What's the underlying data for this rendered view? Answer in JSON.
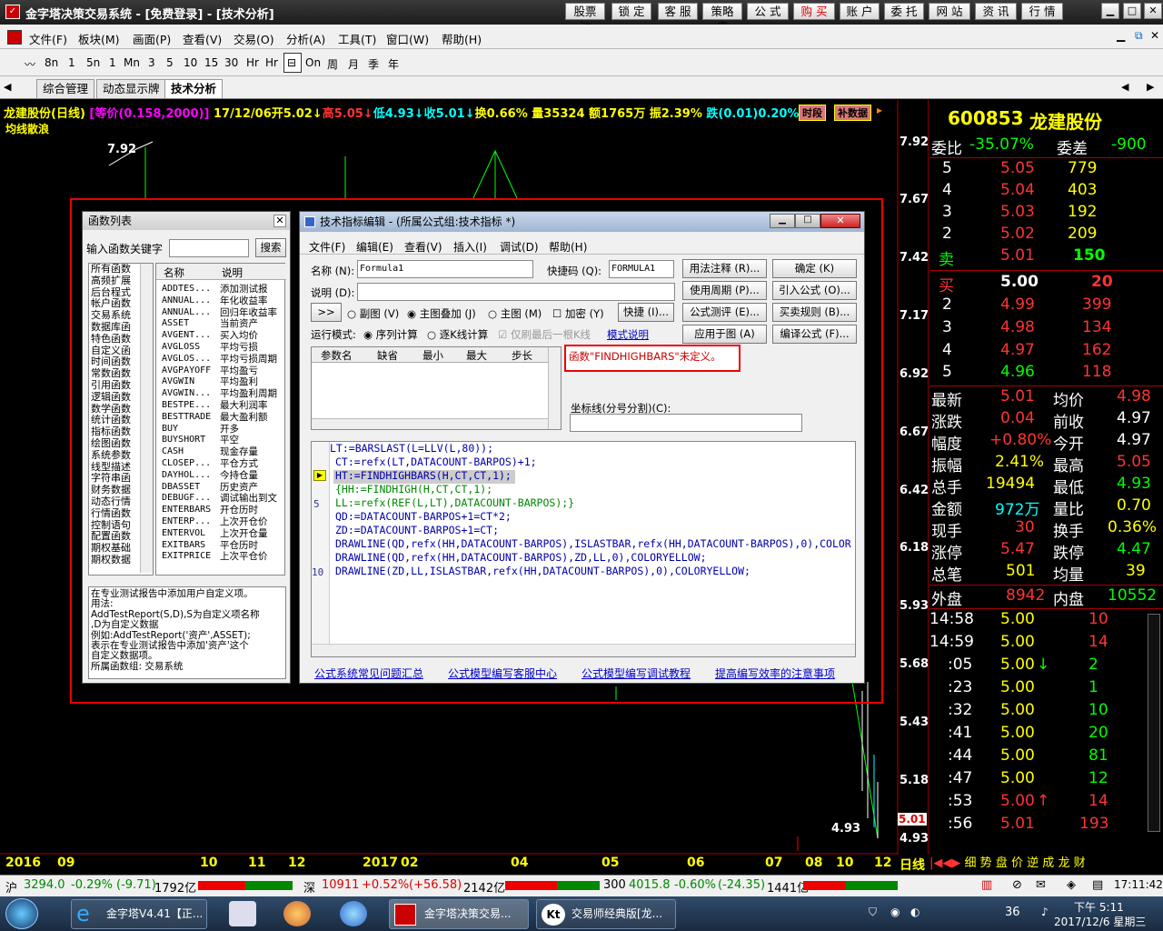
{
  "window": {
    "title": "金字塔决策交易系统 - [免费登录] - [技术分析]",
    "top_buttons": [
      "股票池",
      "锁 定",
      "客 服",
      "策略库",
      "公 式",
      "购 买",
      "账 户",
      "委 托",
      "网 站",
      "资 讯",
      "行 情"
    ]
  },
  "menu": [
    "文件(F)",
    "板块(M)",
    "画面(P)",
    "查看(V)",
    "交易(O)",
    "分析(A)",
    "工具(T)",
    "窗口(W)",
    "帮助(H)"
  ],
  "periods": [
    "5n",
    "1",
    "Mn",
    "3",
    "5",
    "10",
    "15",
    "30",
    "Hr",
    "On",
    "周",
    "月",
    "季",
    "年"
  ],
  "period_extra": "8n",
  "period_extra2": "1",
  "period_hr": "Hr",
  "tabs": [
    "综合管理",
    "动态显示牌",
    "技术分析"
  ],
  "chart": {
    "name": "龙建股份(日线)",
    "equal": "[等价(0.158,2000)]",
    "date": "17/12/06",
    "open": "开5.02↓",
    "high": "高5.05↓",
    "low": "低4.93↓",
    "close": "收5.01↓",
    "turnover": "换0.66%",
    "vol": "量35324",
    "amt": "额1765万",
    "amp": "振2.39%",
    "chg": "跌(0.01)0.20%",
    "btn_period": "时段",
    "btn_data": "补数据",
    "indicator": "均线散浪",
    "hi_label": "7.92",
    "lo_label": "4.93",
    "last_tag": "5.01",
    "price_levels": [
      "7.92",
      "7.67",
      "7.42",
      "7.17",
      "6.92",
      "6.67",
      "6.42",
      "6.18",
      "5.93",
      "5.68",
      "5.43",
      "5.18",
      "4.93"
    ],
    "time_ticks": [
      "2016",
      "09",
      "10",
      "11",
      "12",
      "2017",
      "02",
      "04",
      "05",
      "06",
      "07",
      "08",
      "10",
      "12"
    ],
    "axis_mode": "日线"
  },
  "quote": {
    "code": "600853",
    "name": "龙建股份",
    "ratio_label": "委比",
    "ratio": "-35.07%",
    "diff_label": "委差",
    "diff": "-900",
    "asks": [
      [
        "5",
        "5.05",
        "779"
      ],
      [
        "4",
        "5.04",
        "403"
      ],
      [
        "3",
        "5.03",
        "192"
      ],
      [
        "2",
        "5.02",
        "209"
      ],
      [
        "卖",
        "5.01",
        "150"
      ]
    ],
    "bids": [
      [
        "买",
        "5.00",
        "20"
      ],
      [
        "2",
        "4.99",
        "399"
      ],
      [
        "3",
        "4.98",
        "134"
      ],
      [
        "4",
        "4.97",
        "162"
      ],
      [
        "5",
        "4.96",
        "118"
      ]
    ],
    "stats": [
      [
        "最新",
        "5.01",
        "均价",
        "4.98"
      ],
      [
        "涨跌",
        "0.04",
        "前收",
        "4.97"
      ],
      [
        "幅度",
        "+0.80%",
        "今开",
        "4.97"
      ],
      [
        "振幅",
        "2.41%",
        "最高",
        "5.05"
      ],
      [
        "总手",
        "19494",
        "最低",
        "4.93"
      ],
      [
        "金额",
        "972万",
        "量比",
        "0.70"
      ],
      [
        "现手",
        "30",
        "换手",
        "0.36%"
      ],
      [
        "涨停",
        "5.47",
        "跌停",
        "4.47"
      ],
      [
        "总笔",
        "501",
        "均量",
        "39"
      ]
    ],
    "outer_label": "外盘",
    "outer": "8942",
    "inner_label": "内盘",
    "inner": "10552",
    "ticks": [
      [
        "14:58",
        "5.00",
        "",
        "10"
      ],
      [
        "14:59",
        "5.00",
        "",
        "14"
      ],
      [
        ":05",
        "5.00",
        "↓",
        "2"
      ],
      [
        ":23",
        "5.00",
        "",
        "1"
      ],
      [
        ":32",
        "5.00",
        "",
        "10"
      ],
      [
        ":41",
        "5.00",
        "",
        "20"
      ],
      [
        ":44",
        "5.00",
        "",
        "81"
      ],
      [
        ":47",
        "5.00",
        "",
        "12"
      ],
      [
        ":53",
        "5.00",
        "↑",
        "14"
      ],
      [
        ":56",
        "5.01",
        "",
        "193"
      ]
    ],
    "bottom_tabs": [
      "细",
      "势",
      "盘",
      "价",
      "逆",
      "成",
      "龙",
      "财"
    ]
  },
  "status": {
    "sh": "沪",
    "sh_val": "3294.0",
    "sh_pct": "-0.29%",
    "sh_chg": "(-9.71)",
    "sh_amt": "1792亿",
    "sz": "深",
    "sz_val": "10911",
    "sz_pct": "+0.52%",
    "sz_chg": "(+56.58)",
    "sz_amt": "2142亿",
    "cy": "300",
    "cy_val": "4015.8",
    "cy_pct": "-0.60%",
    "cy_chg": "(-24.35)",
    "cy_amt": "1441亿",
    "time": "17:11:42"
  },
  "taskbar": {
    "tasks": [
      "金字塔V4.41【正...",
      "金字塔决策交易...",
      "交易师经典版[龙..."
    ],
    "clock_time": "下午 5:11",
    "clock_date": "2017/12/6 星期三",
    "tray_num": "36"
  },
  "func_list": {
    "title": "函数列表",
    "search_label": "输入函数关键字",
    "search_btn": "搜索",
    "categories": [
      "所有函数",
      "高频扩展",
      "后台程式",
      "帐户函数",
      "交易系统",
      "数据库函",
      "特色函数",
      "自定义函",
      "时间函数",
      "常数函数",
      "引用函数",
      "逻辑函数",
      "数学函数",
      "统计函数",
      "指标函数",
      "绘图函数",
      "系统参数",
      "线型描述",
      "字符串函",
      "财务数据",
      "动态行情",
      "行情函数",
      "控制语句",
      "配置函数",
      "期权基础",
      "期权数据"
    ],
    "col_name": "名称",
    "col_desc": "说明",
    "funcs": [
      [
        "ADDTES...",
        "添加测试报"
      ],
      [
        "ANNUAL...",
        "年化收益率"
      ],
      [
        "ANNUAL...",
        "回归年收益率"
      ],
      [
        "ASSET",
        "当前资产"
      ],
      [
        "AVGENT...",
        "买入均价"
      ],
      [
        "AVGLOSS",
        "平均亏损"
      ],
      [
        "AVGLOS...",
        "平均亏损周期"
      ],
      [
        "AVGPAYOFF",
        "平均盈亏"
      ],
      [
        "AVGWIN",
        "平均盈利"
      ],
      [
        "AVGWIN...",
        "平均盈利周期"
      ],
      [
        "BESTPE...",
        "最大利润率"
      ],
      [
        "BESTTRADE",
        "最大盈利额"
      ],
      [
        "BUY",
        "开多"
      ],
      [
        "BUYSHORT",
        "平空"
      ],
      [
        "CASH",
        "现金存量"
      ],
      [
        "CLOSEP...",
        "平仓方式"
      ],
      [
        "DAYHOL...",
        "今持仓量"
      ],
      [
        "DBASSET",
        "历史资产"
      ],
      [
        "DEBUGF...",
        "调试输出到文"
      ],
      [
        "ENTERBARS",
        "开仓历时"
      ],
      [
        "ENTERP...",
        "上次开仓价"
      ],
      [
        "ENTERVOL",
        "上次开仓量"
      ],
      [
        "EXITBARS",
        "平仓历时"
      ],
      [
        "EXITPRICE",
        "上次平仓价"
      ]
    ],
    "help": "在专业测试报告中添加用户自定义项。\n用法:\nAddTestReport(S,D),S为自定义项名称\n,D为自定义数据\n例如:AddTestReport('资产',ASSET);\n表示在专业测试报告中添加'资产'这个\n自定义数据项。\n所属函数组: 交易系统"
  },
  "editor": {
    "title": "技术指标编辑 - (所属公式组:技术指标 *)",
    "menu": [
      "文件(F)",
      "编辑(E)",
      "查看(V)",
      "插入(I)",
      "调试(D)",
      "帮助(H)"
    ],
    "name_label": "名称 (N):",
    "name_val": "Formula1",
    "code_label": "快捷码 (Q):",
    "code_val": "FORMULA1",
    "desc_label": "说明 (D):",
    "btns_right": [
      "用法注释 (R)...",
      "确定 (K)",
      "使用周期 (P)...",
      "引入公式 (O)...",
      "公式测评 (E)...",
      "买卖规则 (B)...",
      "应用于图 (A)",
      "编译公式 (F)..."
    ],
    "expand": ">>",
    "radio": [
      "副图 (V)",
      "主图叠加 (J)",
      "主图 (M)"
    ],
    "check_add": "加密 (Y)",
    "quick_btn": "快捷 (I)...",
    "mode_label": "运行模式:",
    "mode": [
      "序列计算",
      "逐K线计算"
    ],
    "only_last": "仅刷最后一根K线",
    "mode_help": "模式说明",
    "param_cols": [
      "参数名",
      "缺省",
      "最小",
      "最大",
      "步长"
    ],
    "error": "函数\"FINDHIGHBARS\"未定义。",
    "coord_label": "坐标线(分号分割)(C):",
    "code_lines": [
      "LT:=BARSLAST(L=LLV(L,80));",
      "CT:=refx(LT,DATACOUNT-BARPOS)+1;",
      "HT:=FINDHIGHBARS(H,CT,CT,1);",
      "{HH:=FINDHIGH(H,CT,CT,1);",
      "LL:=refx(REF(L,LT),DATACOUNT-BARPOS);}",
      "QD:=DATACOUNT-BARPOS+1=CT*2;",
      "ZD:=DATACOUNT-BARPOS+1=CT;",
      "DRAWLINE(QD,refx(HH,DATACOUNT-BARPOS),ISLASTBAR,refx(HH,DATACOUNT-BARPOS),0),COLOR",
      "DRAWLINE(QD,refx(HH,DATACOUNT-BARPOS),ZD,LL,0),COLORYELLOW;",
      "DRAWLINE(ZD,LL,ISLASTBAR,refx(HH,DATACOUNT-BARPOS),0),COLORYELLOW;"
    ],
    "line_nums": [
      "5",
      "10"
    ],
    "links": [
      "公式系统常见问题汇总",
      "公式模型编写客服中心",
      "公式模型编写调试教程",
      "提高编写效率的注意事项"
    ]
  }
}
